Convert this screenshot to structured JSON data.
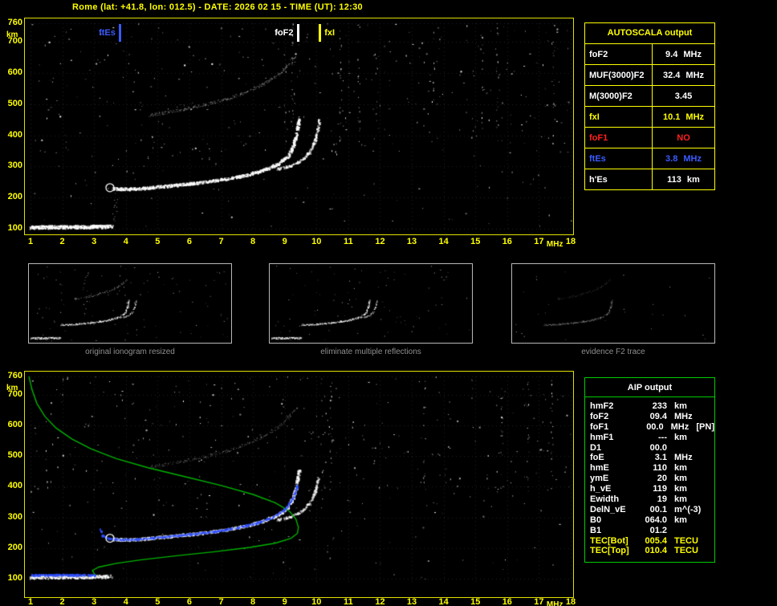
{
  "title": "Rome (lat: +41.8, lon: 012.5) - DATE: 2026 02 15 - TIME (UT): 12:30",
  "colors": {
    "axis_yellow": "#ffff00",
    "plot_border_yellow": "#e0e000",
    "trace_white": "#ffffff",
    "marker_blue": "#3b5bff",
    "alarm_red": "#ff2020",
    "profile_green": "#00b400",
    "aip_border_green": "#00cc00",
    "caption_gray": "#8f8f8f"
  },
  "axis": {
    "x_ticks": [
      1,
      2,
      3,
      4,
      5,
      6,
      7,
      8,
      9,
      10,
      11,
      12,
      13,
      14,
      15,
      16,
      17,
      18
    ],
    "x_unit": "MHz",
    "y_ticks": [
      760,
      700,
      600,
      500,
      400,
      300,
      200,
      100
    ],
    "y_unit": "km"
  },
  "autoscala": {
    "header": "AUTOSCALA output",
    "rows": [
      {
        "label": "foF2",
        "value": "9.4",
        "unit": "MHz",
        "color": "#ffffff"
      },
      {
        "label": "MUF(3000)F2",
        "value": "32.4",
        "unit": "MHz",
        "color": "#ffffff"
      },
      {
        "label": "M(3000)F2",
        "value": "3.45",
        "unit": "",
        "color": "#ffffff"
      },
      {
        "label": "fxI",
        "value": "10.1",
        "unit": "MHz",
        "color": "#ffff00"
      },
      {
        "label": "foF1",
        "value": "NO",
        "unit": "",
        "color": "#ff2020"
      },
      {
        "label": "ftEs",
        "value": "3.8",
        "unit": "MHz",
        "color": "#3b5bff"
      },
      {
        "label": "h'Es",
        "value": "113",
        "unit": "km",
        "color": "#ffffff"
      }
    ]
  },
  "aip": {
    "header": "AIP output",
    "rows": [
      {
        "label": "hmF2",
        "value": "233",
        "unit": "km",
        "color": "#ffffff"
      },
      {
        "label": "foF2",
        "value": "09.4",
        "unit": "MHz",
        "color": "#ffffff"
      },
      {
        "label": "foF1",
        "value": "00.0",
        "unit": "MHz   [PN]",
        "color": "#ffffff"
      },
      {
        "label": "hmF1",
        "value": "---",
        "unit": "km",
        "color": "#ffffff"
      },
      {
        "label": "D1",
        "value": "00.0",
        "unit": "",
        "color": "#ffffff"
      },
      {
        "label": "foE",
        "value": "3.1",
        "unit": "MHz",
        "color": "#ffffff"
      },
      {
        "label": "hmE",
        "value": "110",
        "unit": "km",
        "color": "#ffffff"
      },
      {
        "label": "ymE",
        "value": "20",
        "unit": "km",
        "color": "#ffffff"
      },
      {
        "label": "h_vE",
        "value": "119",
        "unit": "km",
        "color": "#ffffff"
      },
      {
        "label": "Ewidth",
        "value": "19",
        "unit": "km",
        "color": "#ffffff"
      },
      {
        "label": "DelN_vE",
        "value": "00.1",
        "unit": "m^(-3)",
        "color": "#ffffff"
      },
      {
        "label": "B0",
        "value": "064.0",
        "unit": "km",
        "color": "#ffffff"
      },
      {
        "label": "B1",
        "value": "01.2",
        "unit": "",
        "color": "#ffffff"
      },
      {
        "label": "TEC[Bot]",
        "value": "005.4",
        "unit": "TECU",
        "color": "#ffff00"
      },
      {
        "label": "TEC[Top]",
        "value": "010.4",
        "unit": "TECU",
        "color": "#ffff00"
      }
    ]
  },
  "thumbnails": {
    "captions": [
      "original ionogram resized",
      "eliminate multiple reflections",
      "evidence F2 trace"
    ]
  },
  "chart_data": [
    {
      "type": "scatter",
      "name": "ionogram-top",
      "title": "scaled ionogram with AUTOSCALA markers",
      "xlabel": "MHz",
      "ylabel": "km",
      "xlim": [
        1,
        18
      ],
      "ylim": [
        100,
        760
      ],
      "grid": "dotted",
      "markers": [
        {
          "name": "ftEs",
          "freq_mhz": 3.8,
          "color": "#3b5bff"
        },
        {
          "name": "foF2",
          "freq_mhz": 9.4,
          "color": "#ffffff"
        },
        {
          "name": "fxI",
          "freq_mhz": 10.1,
          "color": "#ffff00"
        }
      ],
      "series": [
        {
          "name": "es-trace",
          "color": "#ffffff",
          "render": "dots",
          "density": 5,
          "size": 2,
          "jitter": 2,
          "alpha": 1,
          "points": [
            [
              1.0,
              106
            ],
            [
              2.0,
              107
            ],
            [
              3.55,
              109
            ]
          ]
        },
        {
          "name": "es-spread",
          "color": "#cccccc",
          "render": "dots",
          "density": 0.35,
          "size": 1,
          "jitter": 3,
          "alpha": 0.8,
          "points": [
            [
              3.62,
              118
            ],
            [
              3.66,
              170
            ],
            [
              3.7,
              238
            ]
          ]
        },
        {
          "name": "f2-ordinary",
          "color": "#ffffff",
          "render": "dots",
          "density": 3.5,
          "size": 2,
          "jitter": 1.6,
          "alpha": 1,
          "points": [
            [
              3.55,
              231
            ],
            [
              3.9,
              229
            ],
            [
              4.4,
              230
            ],
            [
              5.0,
              236
            ],
            [
              5.8,
              244
            ],
            [
              6.6,
              253
            ],
            [
              7.2,
              262
            ],
            [
              7.8,
              274
            ],
            [
              8.3,
              289
            ],
            [
              8.8,
              311
            ],
            [
              9.1,
              336
            ],
            [
              9.25,
              365
            ],
            [
              9.35,
              402
            ],
            [
              9.42,
              442
            ],
            [
              9.45,
              458
            ]
          ]
        },
        {
          "name": "f2-extraordinary",
          "color": "#ffffff",
          "render": "dots",
          "density": 2.2,
          "size": 2,
          "jitter": 1.4,
          "alpha": 0.9,
          "points": [
            [
              8.75,
              293
            ],
            [
              9.15,
              303
            ],
            [
              9.5,
              320
            ],
            [
              9.78,
              348
            ],
            [
              9.95,
              388
            ],
            [
              10.05,
              432
            ],
            [
              10.08,
              452
            ]
          ]
        },
        {
          "name": "second-hop",
          "color": "#e8e8e8",
          "render": "dots",
          "density": 1.4,
          "size": 1,
          "jitter": 1.8,
          "alpha": 0.6,
          "points": [
            [
              4.7,
              465
            ],
            [
              5.5,
              478
            ],
            [
              6.3,
              495
            ],
            [
              7.2,
              518
            ],
            [
              7.9,
              545
            ],
            [
              8.5,
              575
            ],
            [
              8.9,
              605
            ],
            [
              9.15,
              632
            ],
            [
              9.3,
              652
            ]
          ]
        },
        {
          "name": "echo-start-marker",
          "color": "#ffffff",
          "render": "circle",
          "size": 5,
          "alpha": 1,
          "points": [
            [
              3.5,
              232
            ]
          ]
        }
      ]
    },
    {
      "type": "scatter",
      "name": "ionogram-bottom",
      "title": "ionogram with AIP electron density profile and fitted trace",
      "xlabel": "MHz",
      "ylabel": "km",
      "xlim": [
        1,
        18
      ],
      "ylim": [
        100,
        760
      ],
      "grid": "dotted",
      "series": [
        {
          "name": "es-trace",
          "color": "#ffffff",
          "render": "dots",
          "density": 4,
          "size": 2,
          "jitter": 2,
          "alpha": 0.9,
          "points": [
            [
              1.0,
              106
            ],
            [
              2.0,
              107
            ],
            [
              3.55,
              109
            ]
          ]
        },
        {
          "name": "f2-ordinary",
          "color": "#ffffff",
          "render": "dots",
          "density": 3.2,
          "size": 2,
          "jitter": 1.6,
          "alpha": 0.95,
          "points": [
            [
              3.55,
              231
            ],
            [
              3.9,
              229
            ],
            [
              4.4,
              230
            ],
            [
              5.0,
              236
            ],
            [
              5.8,
              244
            ],
            [
              6.6,
              253
            ],
            [
              7.2,
              262
            ],
            [
              7.8,
              274
            ],
            [
              8.3,
              289
            ],
            [
              8.8,
              311
            ],
            [
              9.1,
              336
            ],
            [
              9.25,
              365
            ],
            [
              9.35,
              402
            ],
            [
              9.42,
              442
            ],
            [
              9.45,
              458
            ]
          ]
        },
        {
          "name": "f2-extraordinary",
          "color": "#ffffff",
          "render": "dots",
          "density": 2,
          "size": 2,
          "jitter": 1.4,
          "alpha": 0.8,
          "points": [
            [
              8.75,
              293
            ],
            [
              9.15,
              303
            ],
            [
              9.5,
              320
            ],
            [
              9.78,
              348
            ],
            [
              9.95,
              388
            ],
            [
              10.05,
              432
            ]
          ]
        },
        {
          "name": "second-hop",
          "color": "#e0e0e0",
          "render": "dots",
          "density": 1.2,
          "size": 1,
          "jitter": 1.8,
          "alpha": 0.45,
          "points": [
            [
              4.7,
              465
            ],
            [
              5.5,
              478
            ],
            [
              6.3,
              495
            ],
            [
              7.2,
              518
            ],
            [
              7.9,
              545
            ],
            [
              8.5,
              575
            ],
            [
              8.9,
              605
            ],
            [
              9.15,
              632
            ],
            [
              9.3,
              652
            ]
          ]
        },
        {
          "name": "profile",
          "color": "#00b400",
          "render": "line",
          "width": 1.4,
          "alpha": 1,
          "points": [
            [
              0.95,
              760
            ],
            [
              1.05,
              716
            ],
            [
              1.2,
              672
            ],
            [
              1.45,
              630
            ],
            [
              1.8,
              592
            ],
            [
              2.3,
              556
            ],
            [
              2.9,
              524
            ],
            [
              3.7,
              492
            ],
            [
              4.7,
              462
            ],
            [
              5.9,
              432
            ],
            [
              7.0,
              404
            ],
            [
              8.0,
              375
            ],
            [
              8.7,
              348
            ],
            [
              9.15,
              320
            ],
            [
              9.35,
              295
            ],
            [
              9.43,
              268
            ],
            [
              9.4,
              248
            ],
            [
              9.2,
              232
            ],
            [
              8.7,
              216
            ],
            [
              7.9,
              202
            ],
            [
              6.8,
              188
            ],
            [
              5.6,
              175
            ],
            [
              4.5,
              162
            ],
            [
              3.7,
              150
            ],
            [
              3.15,
              138
            ],
            [
              2.95,
              127
            ],
            [
              3.0,
              117
            ],
            [
              3.08,
              110
            ]
          ]
        },
        {
          "name": "autoscala-trace",
          "color": "#3050ff",
          "render": "dots",
          "density": 2.2,
          "size": 2,
          "jitter": 1,
          "alpha": 1,
          "points": [
            [
              3.18,
              266
            ],
            [
              3.25,
              242
            ],
            [
              3.45,
              232
            ],
            [
              3.8,
              229
            ],
            [
              4.4,
              230
            ],
            [
              5.2,
              238
            ],
            [
              6.0,
              246
            ],
            [
              6.8,
              256
            ],
            [
              7.5,
              268
            ],
            [
              8.1,
              283
            ],
            [
              8.6,
              302
            ],
            [
              9.0,
              328
            ],
            [
              9.2,
              356
            ],
            [
              9.32,
              386
            ],
            [
              9.38,
              408
            ]
          ]
        },
        {
          "name": "autoscala-es",
          "color": "#3050ff",
          "render": "dots",
          "density": 3,
          "size": 2,
          "jitter": 1,
          "alpha": 1,
          "points": [
            [
              1.0,
              113
            ],
            [
              2.0,
              114
            ],
            [
              3.05,
              113
            ]
          ]
        },
        {
          "name": "echo-start-marker",
          "color": "#ffffff",
          "render": "circle",
          "size": 5,
          "alpha": 1,
          "points": [
            [
              3.5,
              232
            ]
          ]
        }
      ]
    }
  ]
}
